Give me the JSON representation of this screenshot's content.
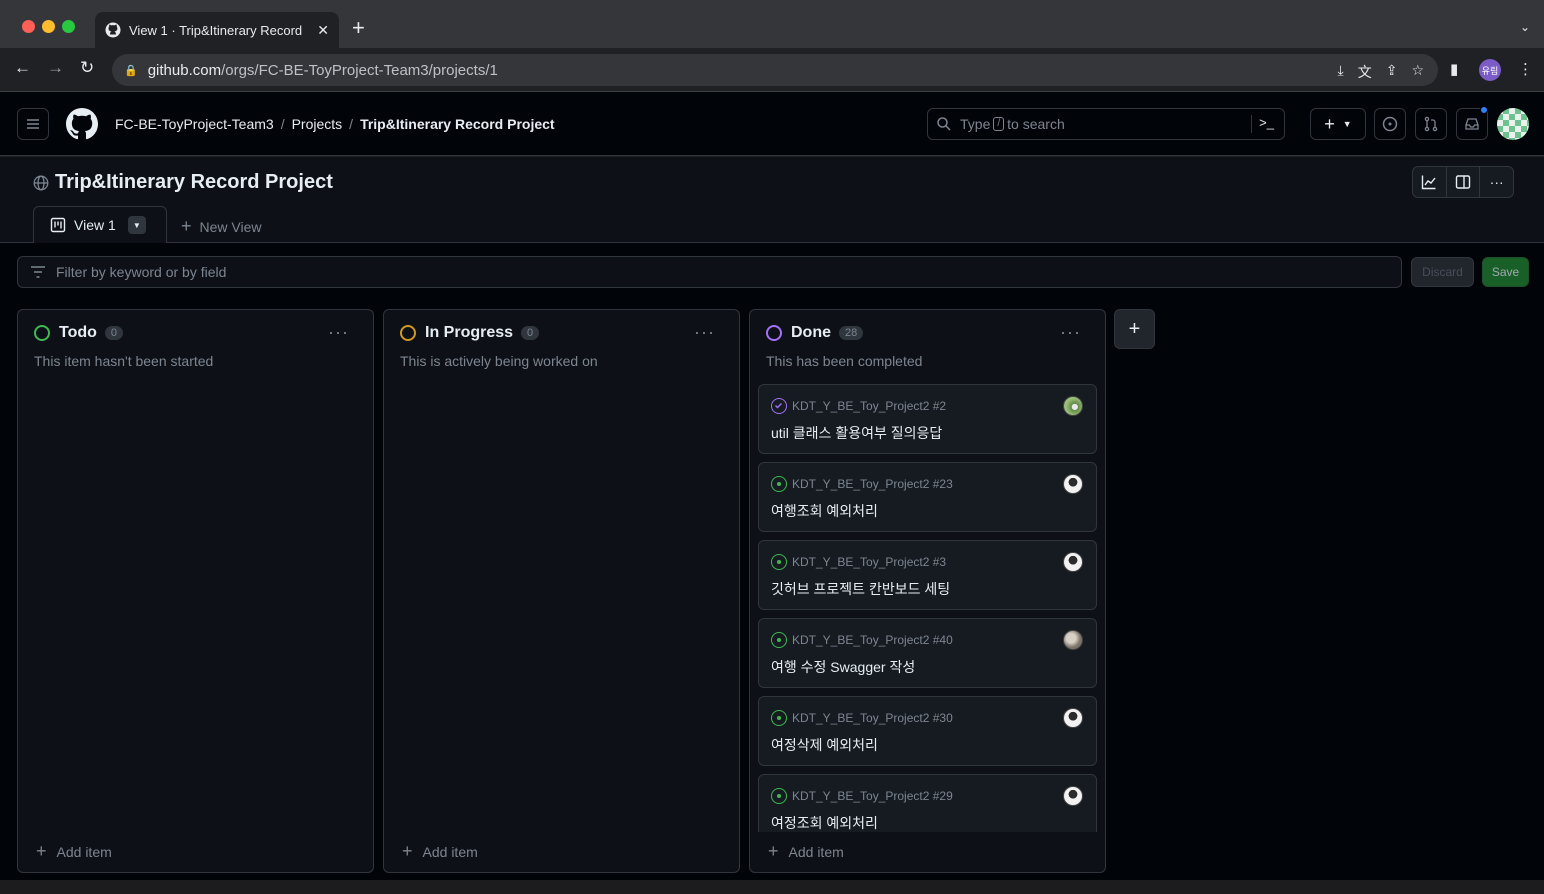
{
  "browser": {
    "tab_title": "View 1 · Trip&Itinerary Record",
    "url_host": "github.com",
    "url_path": "/orgs/FC-BE-ToyProject-Team3/projects/1",
    "profile_label": "유림"
  },
  "header": {
    "breadcrumbs": [
      "FC-BE-ToyProject-Team3",
      "Projects",
      "Trip&Itinerary Record Project"
    ],
    "search_prefix": "Type",
    "search_key": "/",
    "search_suffix": "to search"
  },
  "project": {
    "title": "Trip&Itinerary Record Project",
    "view_tab": "View 1",
    "new_view": "New View",
    "filter_placeholder": "Filter by keyword or by field",
    "discard": "Discard",
    "save": "Save"
  },
  "columns": [
    {
      "name": "Todo",
      "count": "0",
      "description": "This item hasn't been started",
      "color": "#3fb950",
      "add": "Add item",
      "cards": []
    },
    {
      "name": "In Progress",
      "count": "0",
      "description": "This is actively being worked on",
      "color": "#d29922",
      "add": "Add item",
      "cards": []
    },
    {
      "name": "Done",
      "count": "28",
      "description": "This has been completed",
      "color": "#a371f7",
      "add": "Add item",
      "cards": [
        {
          "ref": "KDT_Y_BE_Toy_Project2 #2",
          "title": "util 클래스 활용여부 질의응답",
          "state": "closed",
          "avatar": "green"
        },
        {
          "ref": "KDT_Y_BE_Toy_Project2 #23",
          "title": "여행조회 예외처리",
          "state": "open",
          "avatar": "person"
        },
        {
          "ref": "KDT_Y_BE_Toy_Project2 #3",
          "title": "깃허브 프로젝트 칸반보드 세팅",
          "state": "open",
          "avatar": "person"
        },
        {
          "ref": "KDT_Y_BE_Toy_Project2 #40",
          "title": "여행 수정 Swagger 작성",
          "state": "open",
          "avatar": "gray"
        },
        {
          "ref": "KDT_Y_BE_Toy_Project2 #30",
          "title": "여정삭제 예외처리",
          "state": "open",
          "avatar": "person"
        },
        {
          "ref": "KDT_Y_BE_Toy_Project2 #29",
          "title": "여정조회 예외처리",
          "state": "open",
          "avatar": "person"
        }
      ]
    }
  ],
  "colors": {
    "open": "#3fb950",
    "closed": "#a371f7",
    "accent": "#2f81f7",
    "save": "#238636"
  }
}
